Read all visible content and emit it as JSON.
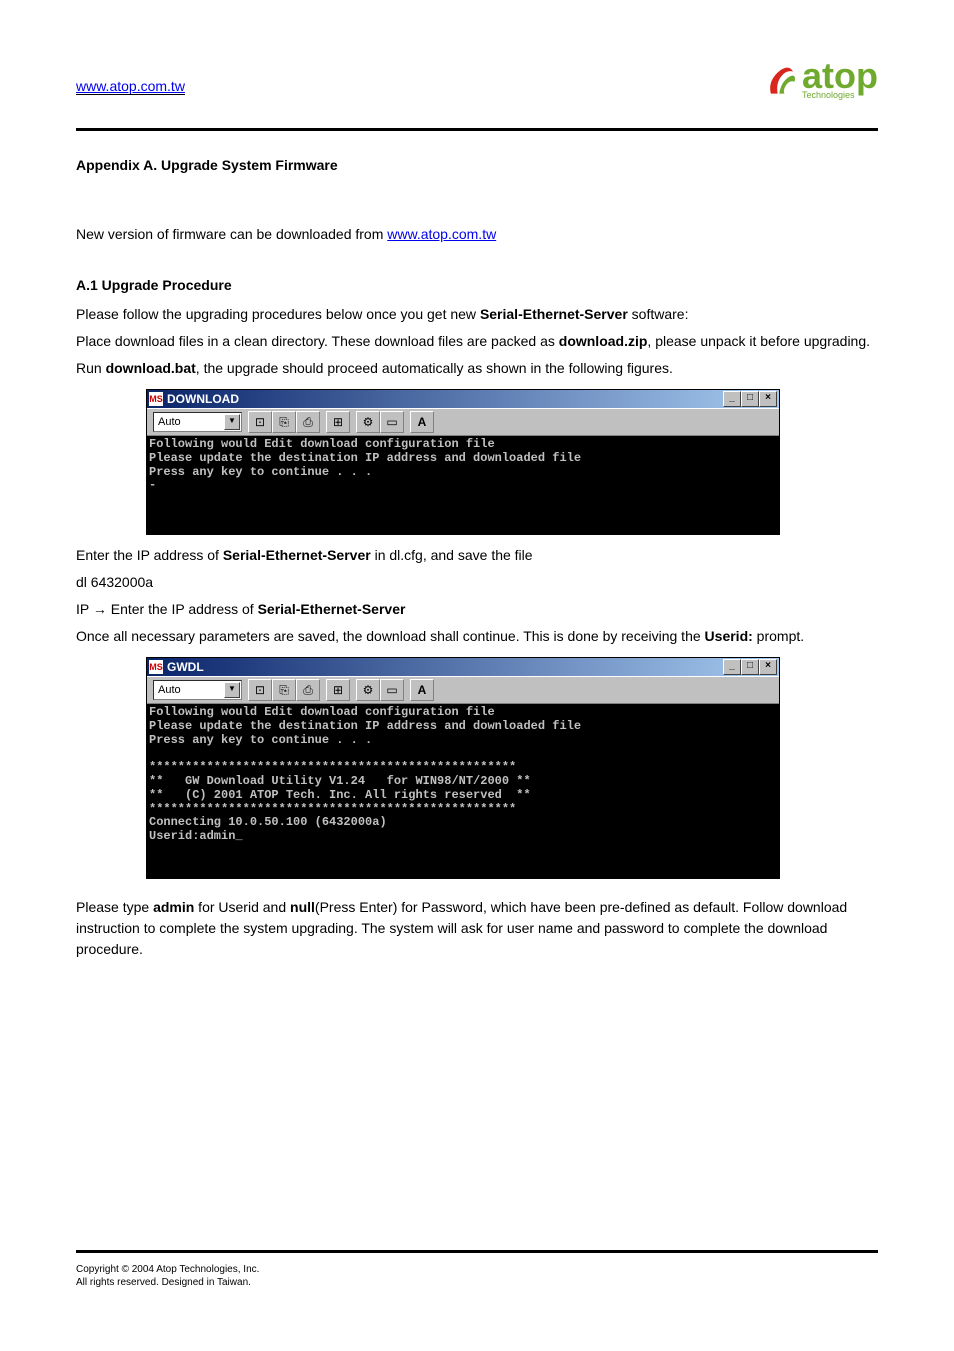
{
  "header": {
    "home_link": "www.atop.com.tw",
    "logo_text": "atop",
    "logo_sub": "Technologies"
  },
  "appendix": {
    "title": "Appendix A. Upgrade System Firmware",
    "intro": "New version of firmware can be downloaded from",
    "link": "www.atop.com.tw",
    "section": "A.1 Upgrade Procedure",
    "p1_a": "Please follow the upgrading procedures below once you get new ",
    "p1_bold1": "Serial-Ethernet-Server",
    "p1_b": " software:",
    "bullet1_a": "Place download files in a clean directory. These download files are packed as ",
    "bullet1_bold": "download.zip",
    "bullet1_b": ", please unpack it before upgrading.",
    "bullet2_a": "Run ",
    "bullet2_bold": "download.bat",
    "bullet2_b": ", the upgrade should proceed automatically as shown in the following figures."
  },
  "screenshot1": {
    "title": "DOWNLOAD",
    "select_value": "Auto",
    "terminal_lines": "Following would Edit download configuration file\nPlease update the destination IP address and downloaded file\nPress any key to continue . . .\n-"
  },
  "mid": {
    "bullet1_a": "Enter the IP address of ",
    "bullet1_bold": "Serial-Ethernet-Server",
    "bullet1_b": " in dl.cfg, and save the file",
    "line1": "dl 6432000a",
    "line2_a": "IP → Enter the IP address of ",
    "line2_bold": "Serial-Ethernet-Server",
    "line3_a": "Once all necessary parameters are saved, the download shall continue. This is done by receiving the ",
    "line3_bold": "Userid:",
    "line3_b": " prompt."
  },
  "screenshot2": {
    "title": "GWDL",
    "select_value": "Auto",
    "terminal_lines": "Following would Edit download configuration file\nPlease update the destination IP address and downloaded file\nPress any key to continue . . .\n\n***************************************************\n**   GW Download Utility V1.24   for WIN98/NT/2000 **\n**   (C) 2001 ATOP Tech. Inc. All rights reserved  **\n***************************************************\nConnecting 10.0.50.100 (6432000a)\nUserid:admin_"
  },
  "post": {
    "bullet1_a": "Please type ",
    "bullet1_bold1": "admin",
    "bullet1_b": " for Userid and ",
    "bullet1_bold2": "null",
    "bullet1_c": "(Press Enter) for Password, which have been pre-defined as default. Follow download instruction to complete the system upgrading. The system will ask for user name and password to complete the download procedure."
  },
  "footer": {
    "copyright": "Copyright © 2004 Atop Technologies, Inc.",
    "rights": "All rights reserved. Designed in Taiwan."
  },
  "win_btns": {
    "min": "_",
    "max": "□",
    "close": "×"
  },
  "toolbar_icons": {
    "mark": "⊡",
    "copy": "⎘",
    "paste": "⎙",
    "full": "⊞",
    "props": "⚙",
    "bg": "▭",
    "font": "A"
  }
}
